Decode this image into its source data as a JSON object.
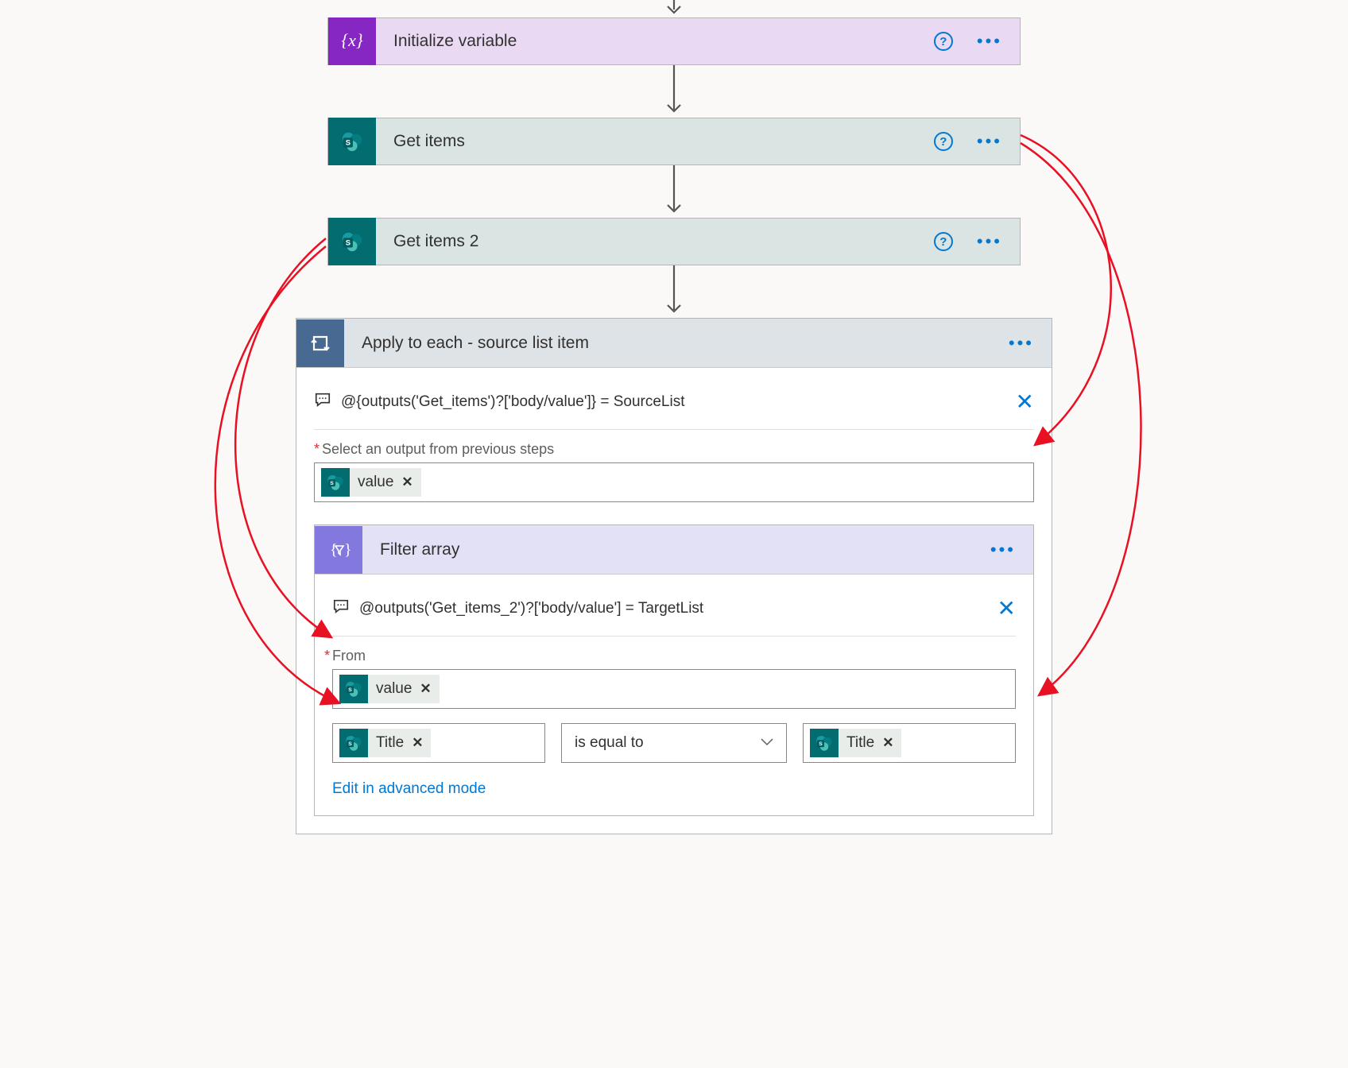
{
  "actions": {
    "init_var": {
      "title": "Initialize variable"
    },
    "get_items": {
      "title": "Get items"
    },
    "get_items_2": {
      "title": "Get items 2"
    },
    "apply_each": {
      "title": "Apply to each - source list item",
      "comment": "@{outputs('Get_items')?['body/value']} = SourceList",
      "select_label": "Select an output from previous steps",
      "token_value": "value"
    },
    "filter_array": {
      "title": "Filter array",
      "comment": "@outputs('Get_items_2')?['body/value'] = TargetList",
      "from_label": "From",
      "token_value": "value",
      "left_token": "Title",
      "operator": "is equal to",
      "right_token": "Title",
      "advanced_link": "Edit in advanced mode"
    }
  }
}
